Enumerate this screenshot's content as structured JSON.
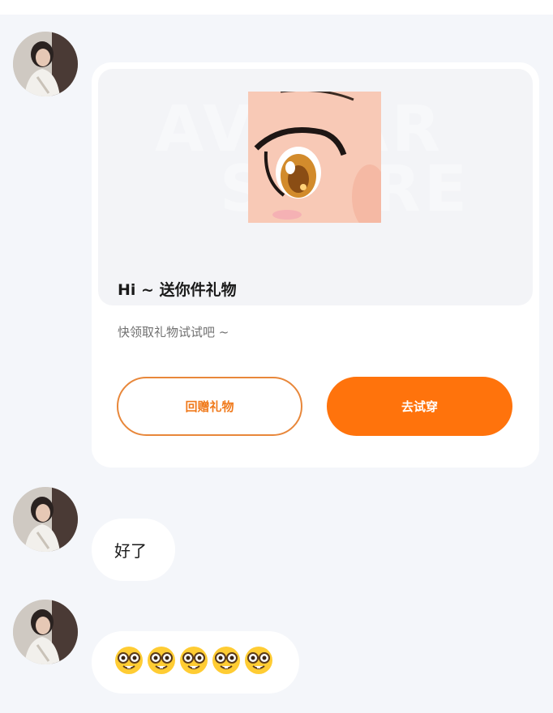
{
  "gift_card": {
    "title": "Hi ~ 送你件礼物",
    "subtitle": "快领取礼物试试吧 ~",
    "return_gift_label": "回赠礼物",
    "try_on_label": "去试穿",
    "banner_watermark_line1": "AVATAR",
    "banner_watermark_line2": "STORE",
    "accent_color": "#ff730c"
  },
  "messages": [
    {
      "type": "text",
      "text": "好了"
    },
    {
      "type": "emoji",
      "emoji_name": "nerd-face",
      "count": 5
    }
  ],
  "icons": {
    "avatar": "user-avatar-photo",
    "emoji": "nerd-face-emoji"
  }
}
